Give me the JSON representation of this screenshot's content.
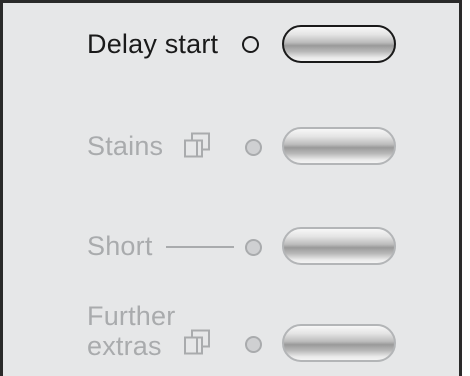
{
  "controls": [
    {
      "label": "Delay start",
      "state": "active",
      "icon": "none"
    },
    {
      "label": "Stains",
      "state": "disabled",
      "icon": "copy-icon"
    },
    {
      "label": "Short",
      "state": "disabled",
      "icon": "dash-line"
    },
    {
      "label_line1": "Further",
      "label_line2": "extras",
      "state": "disabled",
      "icon": "copy-icon"
    }
  ],
  "colors": {
    "panel_bg": "#e6e7e8",
    "active_text": "#1a1a1a",
    "disabled_text": "#a9abad"
  }
}
